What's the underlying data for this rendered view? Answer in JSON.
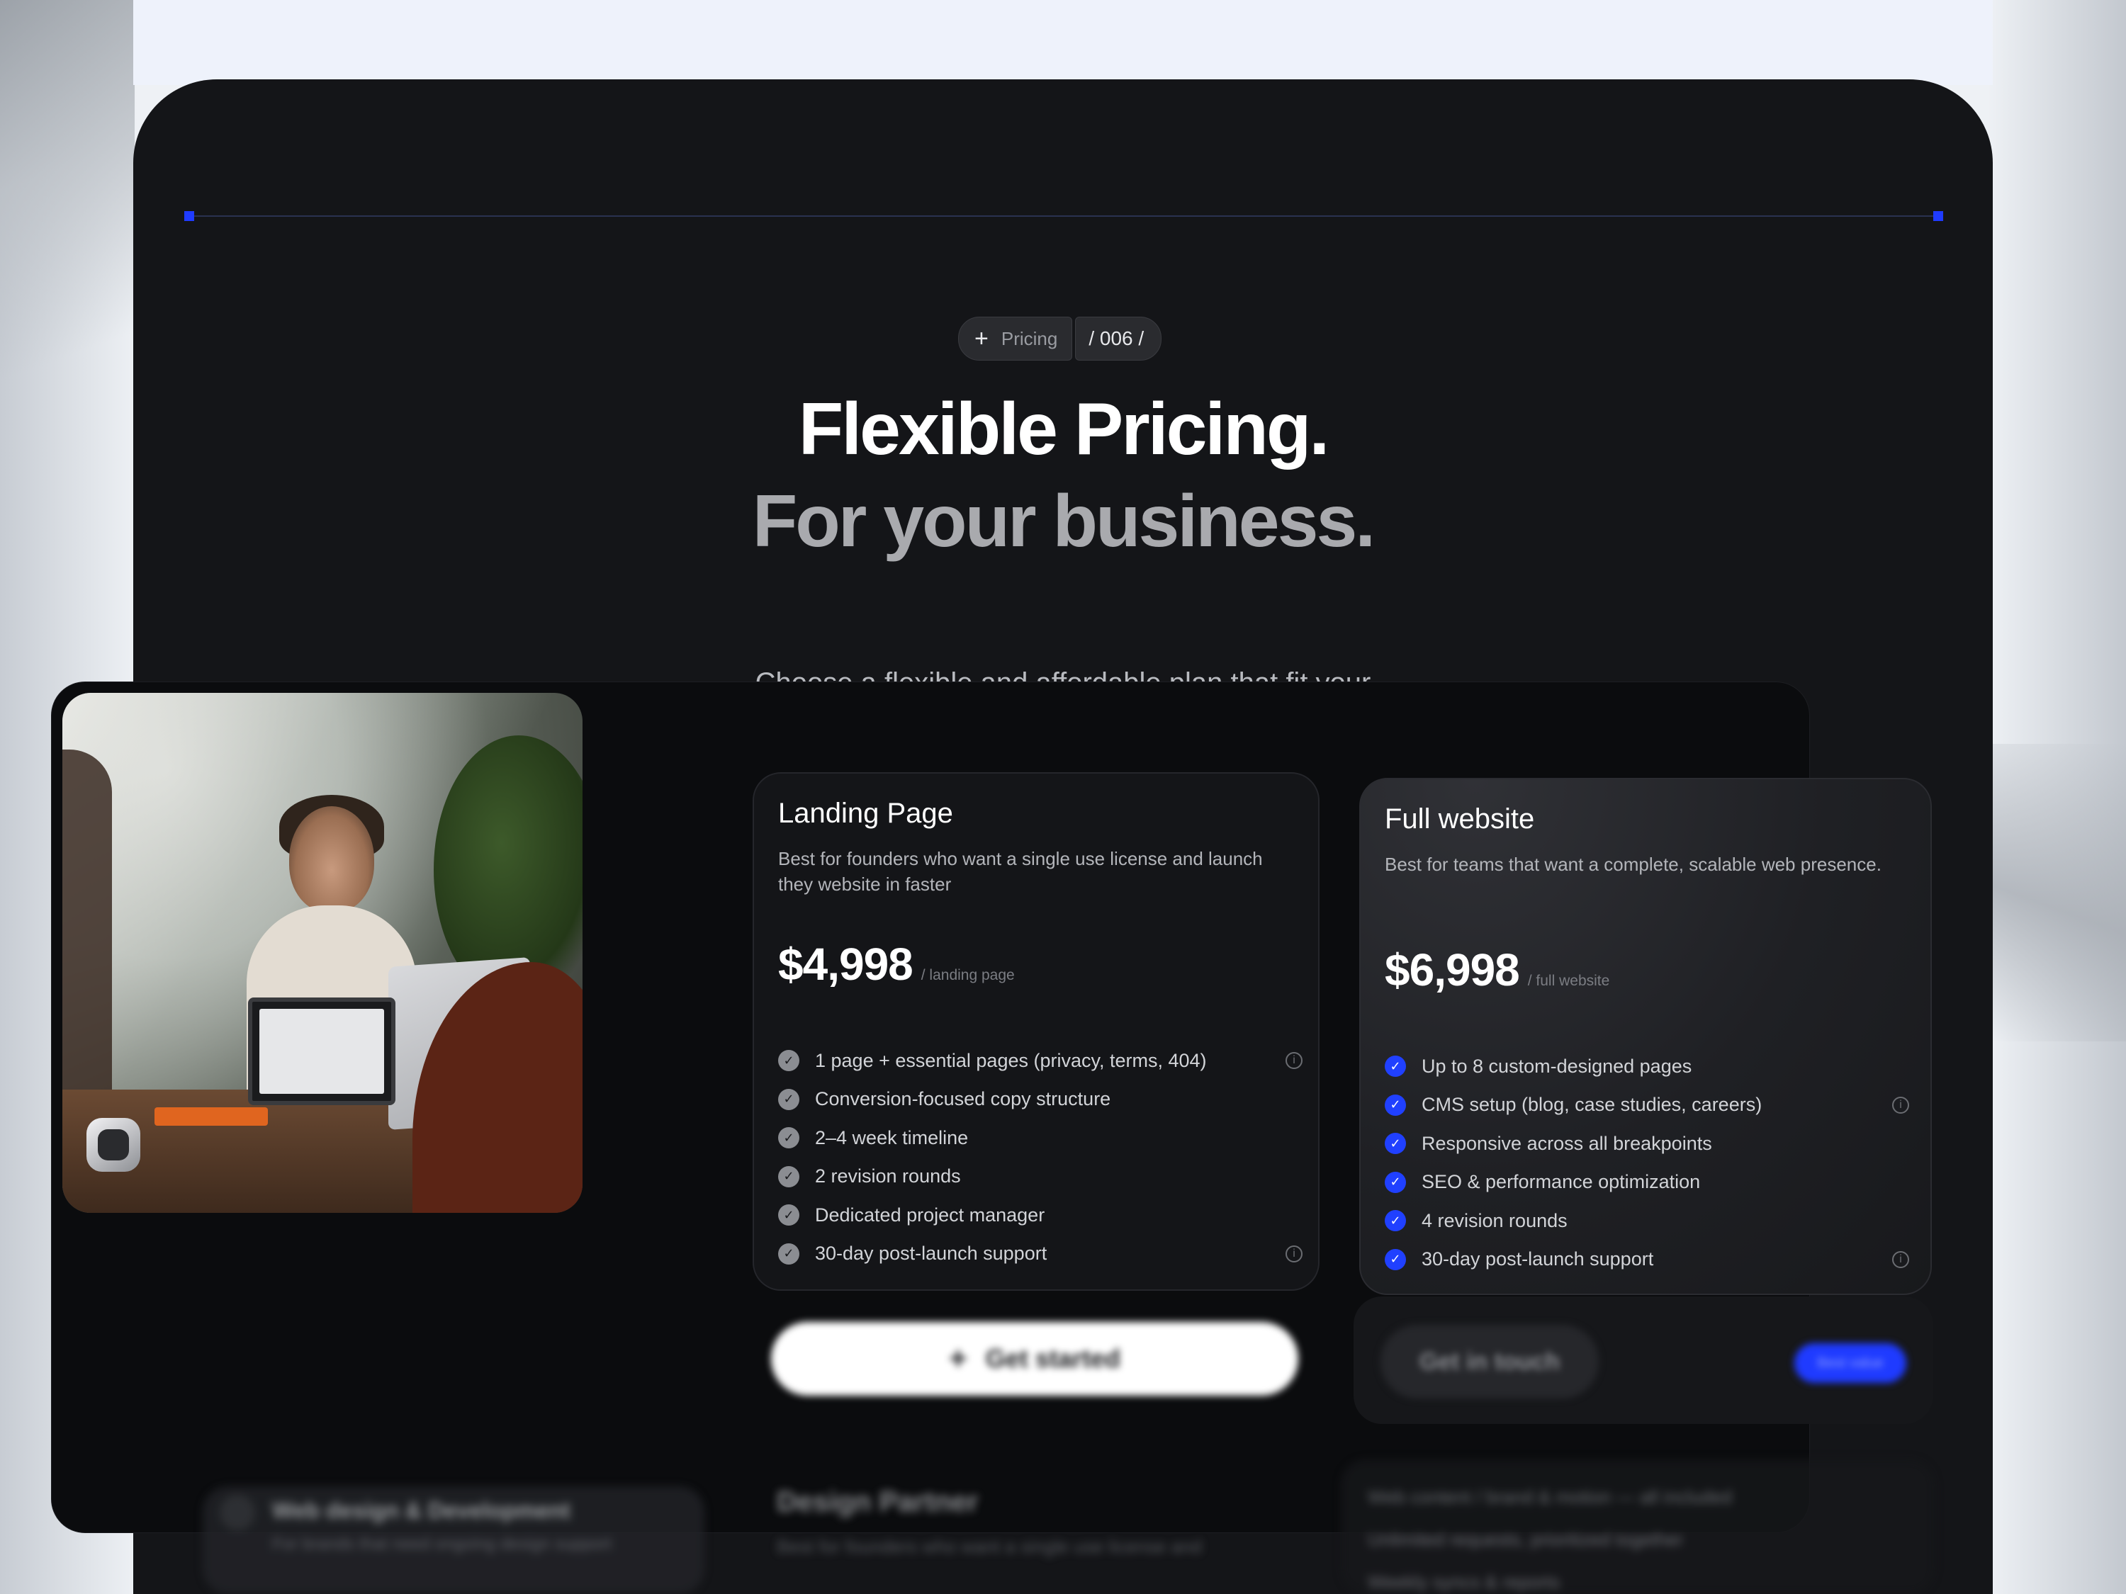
{
  "section_tag": {
    "label": "Pricing",
    "index": "/ 006 /"
  },
  "heading": {
    "line1": "Flexible Pricing.",
    "line2": "For your business."
  },
  "subtitle": "Choose a flexible and affordable plan that fit your business goals.",
  "colors": {
    "accent": "#1f3bff",
    "panel": "#141518",
    "page": "#eef2fb"
  },
  "plans": [
    {
      "title": "Landing Page",
      "description": "Best for founders who want a single use license and launch they website in faster",
      "price": "$4,998",
      "unit": "/ landing page",
      "features": [
        "1 page + essential pages (privacy, terms, 404)",
        "Conversion-focused copy structure",
        "2–4 week timeline",
        "2 revision rounds",
        "Dedicated project manager",
        "30-day post-launch support"
      ],
      "cta": "Get started"
    },
    {
      "title": "Full website",
      "description": "Best for teams that want a complete, scalable web presence.",
      "price": "$6,998",
      "unit": "/ full website",
      "features": [
        "Up to 8 custom-designed pages",
        "CMS setup (blog, case studies, careers)",
        "Responsive across all breakpoints",
        "SEO & performance optimization",
        "4 revision rounds",
        "30-day post-launch support"
      ],
      "cta": "Get in touch",
      "badge": "Best value"
    }
  ],
  "lower": {
    "card_a_title": "Web design & Development",
    "card_a_sub": "For brands that need ongoing design support",
    "card_b_title": "Design Partner",
    "card_b_sub": "Best for founders who want a single use license and",
    "list": [
      "Web content / brand & motion — all included",
      "Unlimited requests, prioritized together",
      "Weekly syncs & reports"
    ]
  }
}
